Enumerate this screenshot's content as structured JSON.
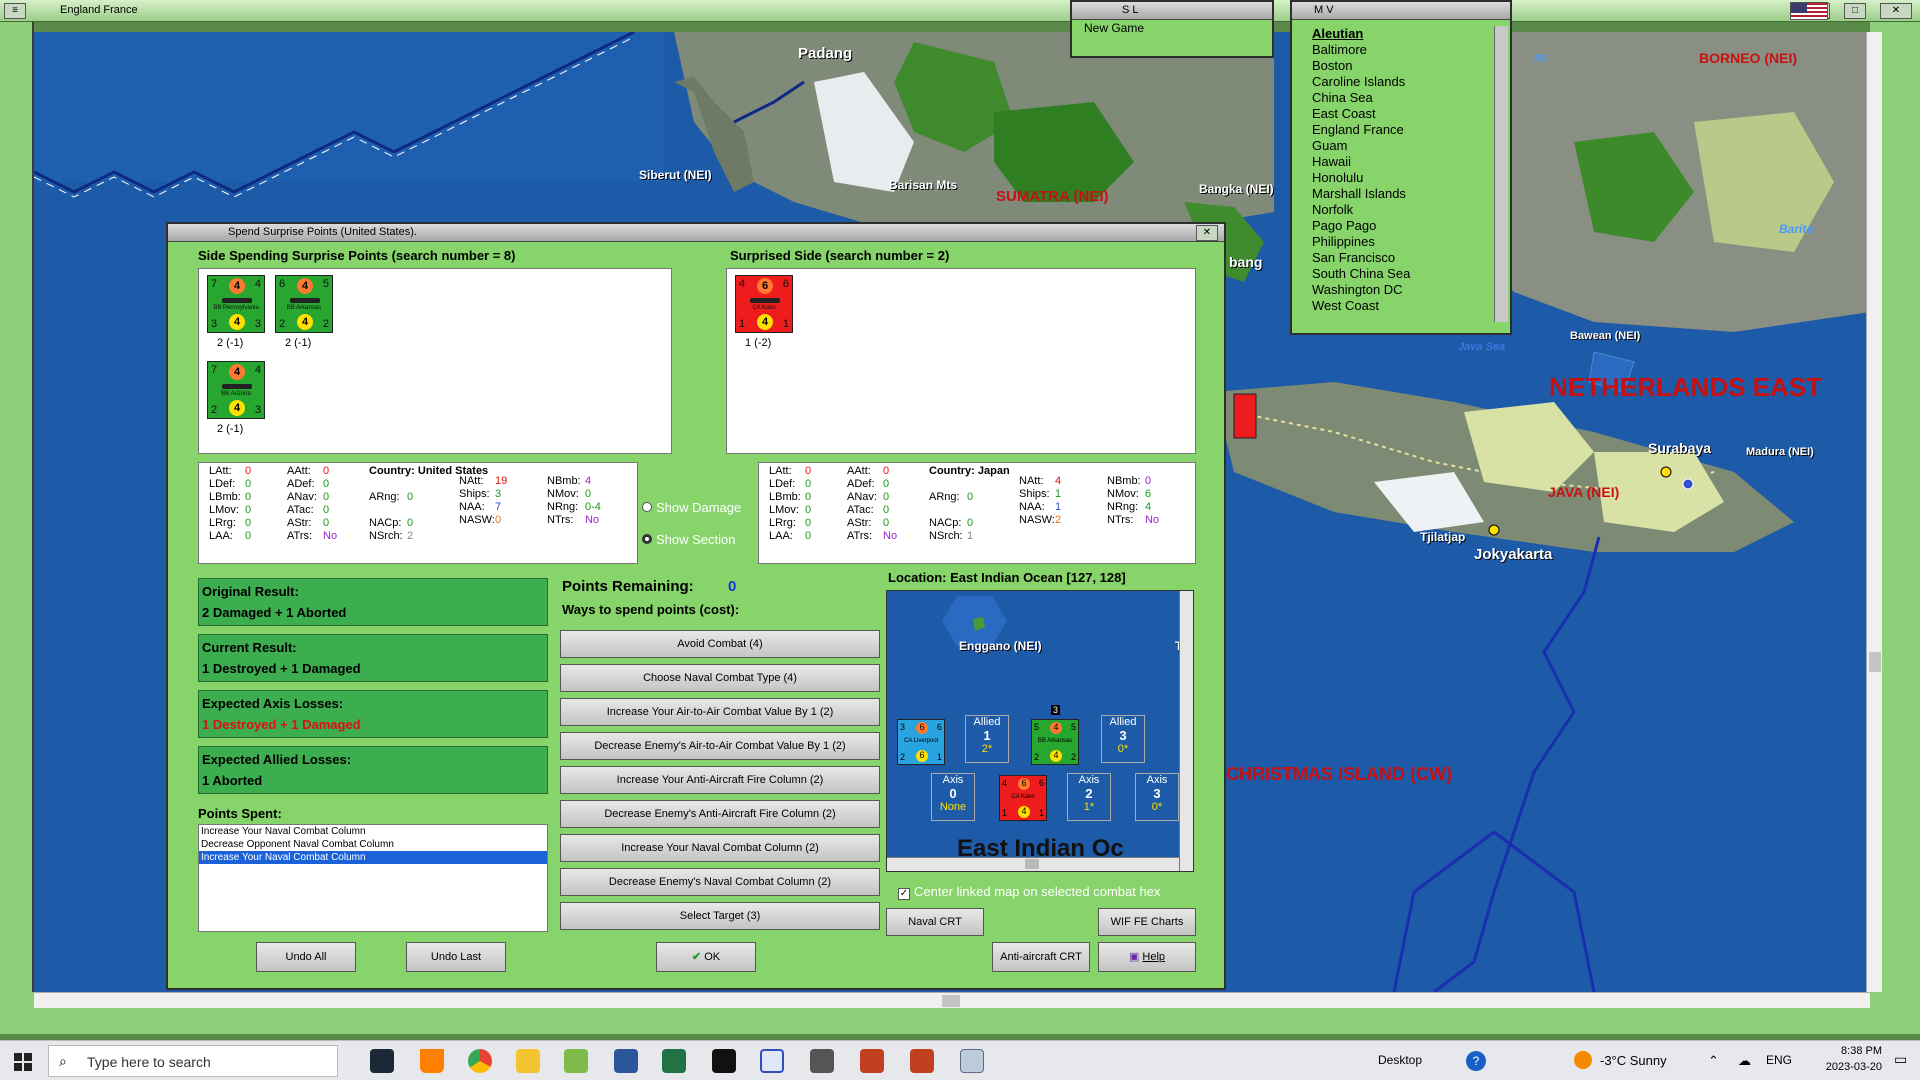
{
  "window": {
    "title": "England France"
  },
  "map": {
    "labels": {
      "padang": "Padang",
      "siberut": "Siberut (NEI)",
      "barisan": "Barisan Mts",
      "sumatra": "SUMATRA (NEI)",
      "bangka": "Bangka (NEI)",
      "palembang_partial": "bang",
      "borneo": "BORNEO (NEI)",
      "barito": "Barito",
      "bawean": "Bawean (NEI)",
      "java_sea": "Java Sea",
      "netherlands_east": "NETHERLANDS EAST",
      "surabaya": "Surabaya",
      "madura": "Madura (NEI)",
      "java": "JAVA (NEI)",
      "tjilatjap": "Tjilatjap",
      "jokyakarta": "Jokyakarta",
      "christmas": "CHRISTMAS ISLAND (CW)",
      "partial_as": "as"
    }
  },
  "sl_window": {
    "title": "S L",
    "items": [
      "New Game"
    ]
  },
  "mv_window": {
    "title": "M V",
    "items": [
      "Aleutian",
      "Baltimore",
      "Boston",
      "Caroline Islands",
      "China Sea",
      "East Coast",
      "England France",
      "Guam",
      "Hawaii",
      "Honolulu",
      "Marshall Islands",
      "Norfolk",
      "Pago Pago",
      "Philippines",
      "San Francisco",
      "South China Sea",
      "Washington DC",
      "West Coast"
    ],
    "selected_index": 0
  },
  "dialog": {
    "title": "Spend Surprise Points (United States).",
    "left_header": "Side Spending Surprise Points (search number = 8)",
    "right_header": "Surprised Side (search number = 2)",
    "left_units": [
      {
        "name": "BB Pennsylvania",
        "tl": "7",
        "top": "4",
        "tr": "4",
        "bl": "3",
        "bot": "4",
        "br": "3",
        "label": "2 (-1)",
        "color": "#27a630"
      },
      {
        "name": "BB Arkansas",
        "tl": "6",
        "top": "4",
        "tr": "5",
        "bl": "2",
        "bot": "4",
        "br": "2",
        "label": "2 (-1)",
        "color": "#27a630"
      },
      {
        "name": "BB Arizona",
        "tl": "7",
        "top": "4",
        "tr": "4",
        "bl": "2",
        "bot": "4",
        "br": "3",
        "label": "2 (-1)",
        "color": "#27a630"
      }
    ],
    "right_units": [
      {
        "name": "CA Kako",
        "tl": "4",
        "top": "6",
        "tr": "6",
        "bl": "1",
        "bot": "4",
        "br": "1",
        "label": "1 (-2)",
        "color": "#ee1c1c"
      }
    ],
    "left_stats": {
      "country_label": "Country: United States",
      "LAtt": "0",
      "LDef": "0",
      "LBmb": "0",
      "LMov": "0",
      "LRrg": "0",
      "LAA": "0",
      "AAtt": "0",
      "ADef": "0",
      "ANav": "0",
      "ATac": "0",
      "AStr": "0",
      "ATrs": "No",
      "ARng": "0",
      "NACp": "0",
      "NSrch": "2",
      "NAtt": "19",
      "Ships": "3",
      "NAA": "7",
      "NASW": "0",
      "NBmb": "4",
      "NMov": "0",
      "NRng": "0-4",
      "NTrs": "No"
    },
    "right_stats": {
      "country_label": "Country: Japan",
      "LAtt": "0",
      "LDef": "0",
      "LBmb": "0",
      "LMov": "0",
      "LRrg": "0",
      "LAA": "0",
      "AAtt": "0",
      "ADef": "0",
      "ANav": "0",
      "ATac": "0",
      "AStr": "0",
      "ATrs": "No",
      "ARng": "0",
      "NACp": "0",
      "NSrch": "1",
      "NAtt": "4",
      "Ships": "1",
      "NAA": "1",
      "NASW": "2",
      "NBmb": "0",
      "NMov": "6",
      "NRng": "4",
      "NTrs": "No"
    },
    "show_damage": "Show Damage",
    "show_section": "Show Section",
    "original_result": {
      "label": "Original Result:",
      "value": "2 Damaged + 1 Aborted"
    },
    "current_result": {
      "label": "Current Result:",
      "value": "1 Destroyed + 1 Damaged"
    },
    "axis_losses": {
      "label": "Expected Axis Losses:",
      "value": "1 Destroyed + 1 Damaged"
    },
    "allied_losses": {
      "label": "Expected Allied Losses:",
      "value": "1 Aborted"
    },
    "points_spent_label": "Points Spent:",
    "points_spent": [
      "Increase Your Naval Combat Column",
      "Decrease Opponent Naval Combat Column",
      "Increase Your Naval Combat Column"
    ],
    "points_spent_selected": 2,
    "points_remaining_label": "Points Remaining:",
    "points_remaining": "0",
    "ways_label": "Ways to spend points (cost):",
    "options": [
      "Avoid Combat (4)",
      "Choose Naval Combat Type (4)",
      "Increase Your Air-to-Air Combat Value By 1 (2)",
      "Decrease Enemy's Air-to-Air Combat Value By 1 (2)",
      "Increase Your Anti-Aircraft Fire Column (2)",
      "Decrease Enemy's Anti-Aircraft Fire Column (2)",
      "Increase Your Naval Combat Column (2)",
      "Decrease Enemy's Naval Combat Column (2)",
      "Select Target (3)"
    ],
    "location_label": "Location: East Indian Ocean [127, 128]",
    "minimap": {
      "enggano": "Enggano (NEI)",
      "t_partial": "T",
      "sea_label": "East Indian Oc",
      "allied_boxes": [
        {
          "side": "Allied",
          "num": "1",
          "sub": "2*"
        },
        {
          "side": "Allied",
          "num": "3",
          "sub": "0*"
        }
      ],
      "axis_boxes": [
        {
          "side": "Axis",
          "num": "0",
          "sub": "None"
        },
        {
          "side": "Axis",
          "num": "2",
          "sub": "1*"
        },
        {
          "side": "Axis",
          "num": "3",
          "sub": "0*"
        }
      ],
      "stack_count": "3",
      "ca_liverpool": "CA Liverpool",
      "bb_arkansas": "BB Arkansas",
      "ca_kako": "CA Kako"
    },
    "center_linked": "Center linked map on selected combat hex",
    "buttons": {
      "undo_all": "Undo All",
      "undo_last": "Undo Last",
      "ok": "OK",
      "naval_crt": "Naval CRT",
      "wif_fe": "WIF FE Charts",
      "aa_crt": "Anti-aircraft CRT",
      "help": "Help"
    }
  },
  "taskbar": {
    "search_placeholder": "Type here to search",
    "desktop": "Desktop",
    "weather": "-3°C  Sunny",
    "lang": "ENG",
    "time": "8:38 PM",
    "date": "2023-03-20"
  },
  "colors": {
    "dialog_green": "#86d46a",
    "result_green": "#3cae50",
    "sea": "#1d5aa8",
    "red_text": "#e01010"
  }
}
